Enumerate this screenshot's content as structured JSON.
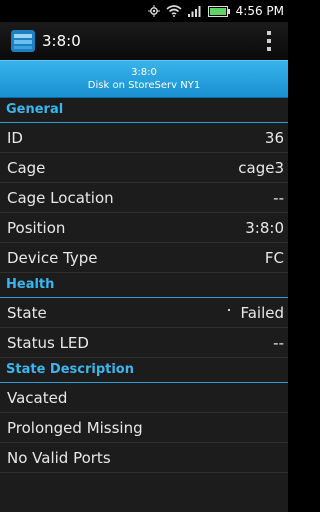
{
  "status": {
    "time": "4:56 PM"
  },
  "header": {
    "title": "3:8:0"
  },
  "band": {
    "line1": "3:8:0",
    "line2": "Disk on StoreServ NY1"
  },
  "sections": {
    "general": {
      "label": "General",
      "rows": [
        {
          "label": "ID",
          "value": "36"
        },
        {
          "label": "Cage",
          "value": "cage3"
        },
        {
          "label": "Cage Location",
          "value": "--"
        },
        {
          "label": "Position",
          "value": "3:8:0"
        },
        {
          "label": "Device Type",
          "value": "FC"
        }
      ]
    },
    "health": {
      "label": "Health",
      "rows": [
        {
          "label": "State",
          "value": "Failed"
        },
        {
          "label": "Status LED",
          "value": "--"
        }
      ]
    },
    "state_description": {
      "label": "State Description",
      "rows": [
        {
          "label": "Vacated"
        },
        {
          "label": "Prolonged Missing"
        },
        {
          "label": "No Valid Ports"
        }
      ]
    }
  },
  "colors": {
    "accent": "#3ab6ee",
    "band": "#1a90d0",
    "background": "#1c1c1c"
  },
  "icons": [
    "gps-icon",
    "wifi-icon",
    "signal-icon",
    "battery-icon",
    "app-icon",
    "overflow-menu-icon"
  ]
}
